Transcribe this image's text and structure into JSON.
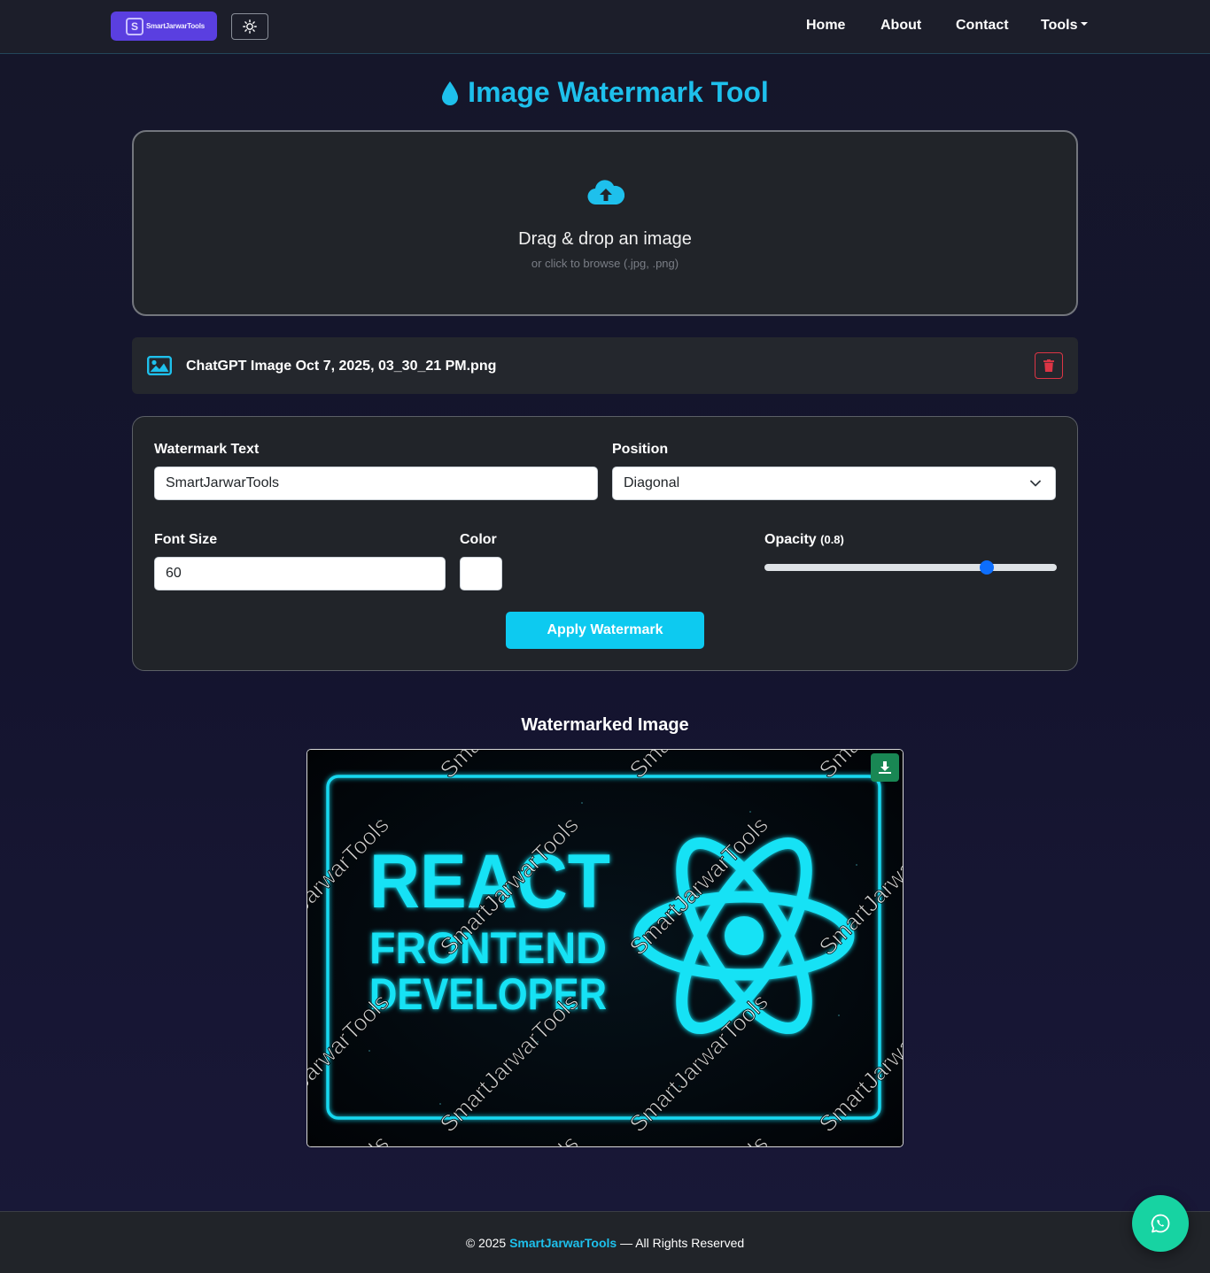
{
  "navbar": {
    "brand": "SmartJarwarTools",
    "links": [
      "Home",
      "About",
      "Contact",
      "Tools"
    ]
  },
  "page": {
    "title": "Image Watermark Tool"
  },
  "dropzone": {
    "title": "Drag & drop an image",
    "subtitle": "or click to browse (.jpg, .png)"
  },
  "file": {
    "name": "ChatGPT Image Oct 7, 2025, 03_30_21 PM.png"
  },
  "settings": {
    "watermark_text_label": "Watermark Text",
    "watermark_text_value": "SmartJarwarTools",
    "position_label": "Position",
    "position_value": "Diagonal",
    "font_size_label": "Font Size",
    "font_size_value": "60",
    "color_label": "Color",
    "color_value": "#ffffff",
    "opacity_label": "Opacity",
    "opacity_display": "(0.8)",
    "opacity_value": 0.8,
    "apply_label": "Apply Watermark"
  },
  "result": {
    "title": "Watermarked Image",
    "image_text": {
      "line1": "REACT",
      "line2": "FRONTEND",
      "line3": "DEVELOPER"
    },
    "watermark": "SmartJarwarTools"
  },
  "footer": {
    "prefix": "© 2025 ",
    "brand": "SmartJarwarTools",
    "suffix": " — All Rights Reserved"
  },
  "colors": {
    "accent": "#1ec0ec",
    "brand": "#5a3fe0",
    "apply": "#0dcaf0",
    "danger": "#dc3545",
    "download": "#198754",
    "whatsapp": "#17d3a2"
  },
  "icons": [
    "sun-icon",
    "water-drop-icon",
    "cloud-upload-icon",
    "image-icon",
    "trash-icon",
    "chevron-down-icon",
    "download-icon",
    "whatsapp-icon"
  ]
}
